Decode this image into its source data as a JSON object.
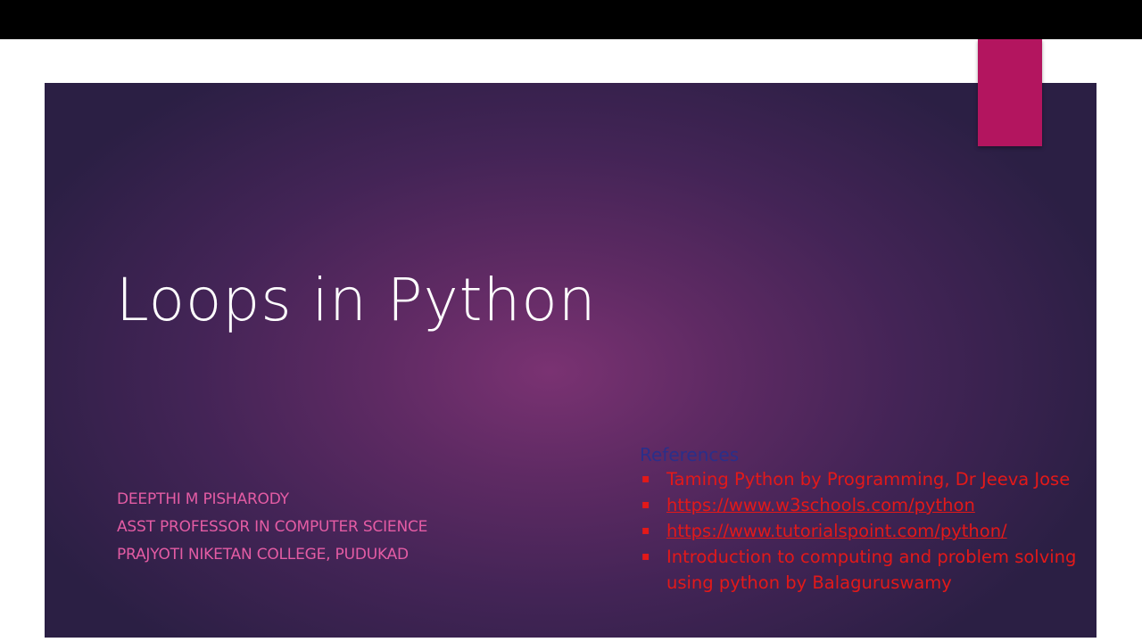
{
  "slide": {
    "title": "Loops in Python",
    "author": {
      "name": "DEEPTHI M PISHARODY",
      "role": "ASST PROFESSOR IN COMPUTER SCIENCE",
      "institution": "PRAJYOTI NIKETAN COLLEGE, PUDUKAD"
    },
    "references": {
      "heading": "References",
      "items": [
        {
          "text": "Taming Python by Programming, Dr Jeeva Jose"
        },
        {
          "text": "https://www.w3schools.com/python"
        },
        {
          "text": "https://www.tutorialspoint.com/python/"
        },
        {
          "text": "Introduction to computing and problem solving using python by Balaguruswamy"
        }
      ]
    }
  },
  "colors": {
    "accent": "#b3155f",
    "author_text": "#e45ca4",
    "references_heading": "#2a2f8a",
    "references_items": "#e31919"
  }
}
